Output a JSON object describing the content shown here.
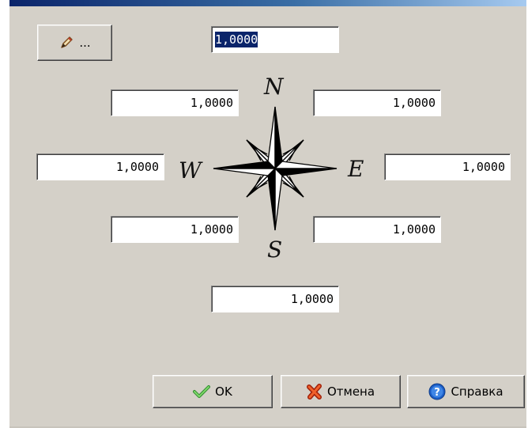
{
  "toolbar": {
    "edit_button_label": "...",
    "edit_icon": "pencil-icon"
  },
  "fields": {
    "top": "1,0000",
    "north_west": "1,0000",
    "north_east": "1,0000",
    "west": "1,0000",
    "east": "1,0000",
    "south_west": "1,0000",
    "south_east": "1,0000",
    "bottom": "1,0000"
  },
  "compass": {
    "north": "N",
    "south": "S",
    "west": "W",
    "east": "E"
  },
  "buttons": {
    "ok_label": "OK",
    "ok_icon": "checkmark-icon",
    "cancel_label": "Отмена",
    "cancel_icon": "cross-icon",
    "help_label": "Справка",
    "help_icon": "help-icon"
  },
  "colors": {
    "dialog_bg": "#d4d0c8",
    "selection_bg": "#0a246a",
    "ok_icon": "#3cb043",
    "cancel_icon": "#d83a1a",
    "help_icon": "#1c5fc8"
  }
}
